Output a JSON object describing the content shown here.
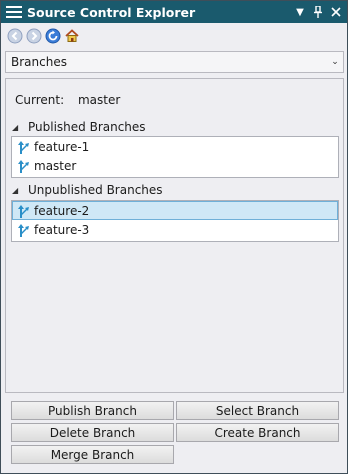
{
  "window": {
    "title": "Source Control Explorer",
    "pin_glyph": "Ԃ"
  },
  "toolbar": {
    "icons": [
      "back-icon",
      "forward-icon",
      "refresh-icon",
      "home-icon"
    ]
  },
  "view_select": {
    "value": "Branches"
  },
  "current": {
    "label": "Current:",
    "value": "master"
  },
  "published": {
    "header": "Published Branches",
    "items": [
      {
        "label": "feature-1"
      },
      {
        "label": "master"
      }
    ]
  },
  "unpublished": {
    "header": "Unpublished Branches",
    "items": [
      {
        "label": "feature-2",
        "selected": true
      },
      {
        "label": "feature-3"
      }
    ]
  },
  "buttons": {
    "publish": "Publish Branch",
    "select": "Select Branch",
    "delete": "Delete Branch",
    "create": "Create Branch",
    "merge": "Merge Branch"
  },
  "colors": {
    "titlebar": "#1a5a6d",
    "selection": "#cfe8f6",
    "branch_icon": "#2a8fc8"
  }
}
